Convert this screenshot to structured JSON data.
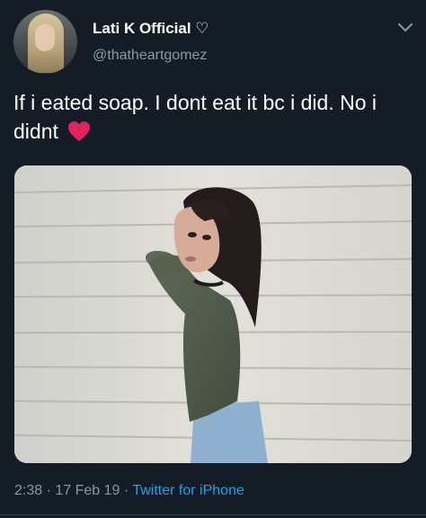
{
  "author": {
    "display_name": "Lati K Official ♡",
    "handle": "@thatheartgomez",
    "avatar": "profile-photo-avatar"
  },
  "tweet": {
    "text": "If i eated soap. I dont eat it bc i did. No i didnt",
    "emoji": "red-heart-icon"
  },
  "meta": {
    "time": "2:38",
    "separator1": " · ",
    "date": "17 Feb 19",
    "separator2": " · ",
    "source": "Twitter for iPhone"
  },
  "colors": {
    "background": "#141d26",
    "secondary_text": "#8899a6",
    "link": "#1da1f2",
    "heart": "#e0245e"
  },
  "icons": {
    "menu": "chevron-down-icon"
  }
}
